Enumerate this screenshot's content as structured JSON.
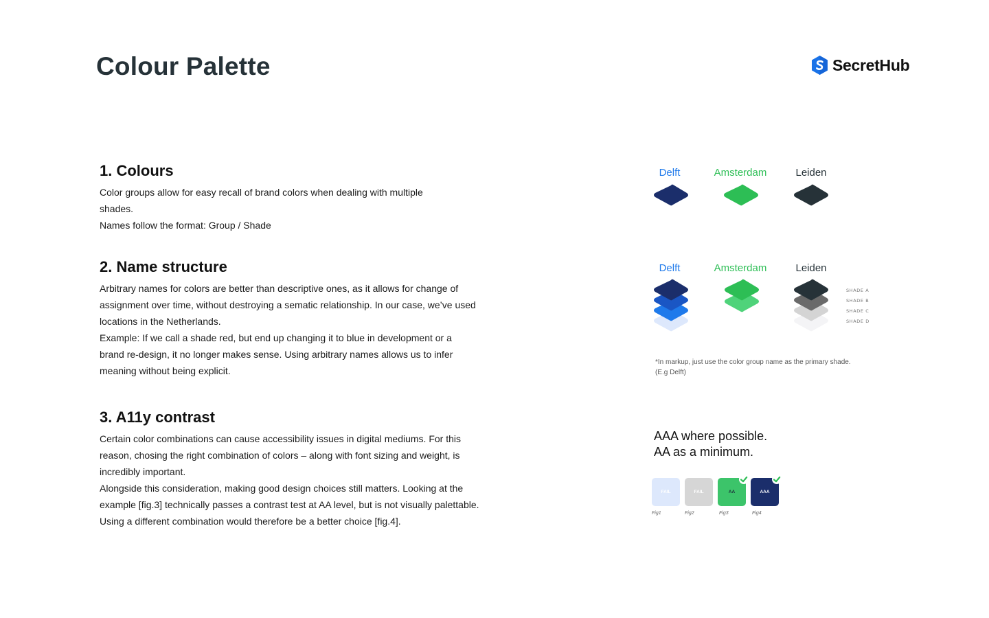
{
  "page": {
    "title": "Colour Palette"
  },
  "brand": {
    "name": "SecretHub",
    "logo_icon": "hexagon-s-icon",
    "logo_color": "#1a73e8"
  },
  "colors": {
    "delft": "#1b2e6b",
    "delft_b": "#1a56c4",
    "delft_c": "#1f7aeb",
    "delft_d": "#dde8fc",
    "amsterdam": "#2dbe55",
    "amsterdam_b": "#4fd37a",
    "leiden": "#263238",
    "leiden_b": "#6a6a6a",
    "leiden_c": "#d4d4d4",
    "leiden_d": "#f4f4f6",
    "delft_label": "#1f7aeb",
    "amsterdam_label": "#2dbe55",
    "leiden_label": "#263238",
    "fig1": "#dde8fc",
    "fig2": "#d6d6d6",
    "fig3": "#3cc46a",
    "fig4": "#1b2e6b"
  },
  "sections": {
    "colours": {
      "heading": "1. Colours",
      "lines": [
        "Color groups allow for easy recall of brand colors when dealing with multiple shades.",
        "Names follow the format:  Group / Shade"
      ]
    },
    "names": {
      "heading": "2. Name structure",
      "lines": [
        "Arbitrary names for colors are better than descriptive ones, as it allows for change of assignment over time, without destroying a sematic relationship. In our case, we’ve used locations in the Netherlands.",
        "Example:  If we call a shade red, but end up changing it to blue in development or a brand re-design, it no longer makes sense. Using arbitrary names allows us to infer meaning without being explicit."
      ]
    },
    "a11y": {
      "heading": "3. A11y contrast",
      "lines": [
        "Certain color combinations can cause accessibility issues in digital mediums. For this reason, chosing the right combination of colors – along with font sizing and weight, is incredibly important.",
        "Alongside this consideration, making good design choices still matters. Looking at the example [fig.3] technically passes a contrast test at AA level, but is not visually palettable. Using a different combination would therefore be a better choice [fig.4]."
      ]
    }
  },
  "groups": [
    "Delft",
    "Amsterdam",
    "Leiden"
  ],
  "shades": [
    "SHADE A",
    "SHADE B",
    "SHADE C",
    "SHADE D"
  ],
  "note": "*In markup, just use the color group name as the primary shade. (E.g Delft)",
  "contrast": {
    "line1_strong": "AAA",
    "line1_rest": " where possible.",
    "line2_strong": "AA",
    "line2_rest": " as a minimum.",
    "figs": [
      {
        "badge": "FAIL",
        "caption": "Fig1",
        "pass": false
      },
      {
        "badge": "FAIL",
        "caption": "Fig2",
        "pass": false
      },
      {
        "badge": "AA",
        "caption": "Fig3",
        "pass": true
      },
      {
        "badge": "AAA",
        "caption": "Fig4",
        "pass": true
      }
    ]
  }
}
